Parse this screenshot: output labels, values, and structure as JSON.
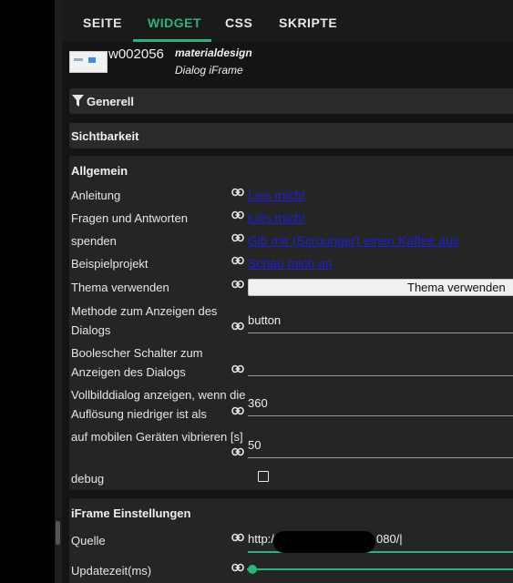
{
  "tabs": [
    {
      "label": "SEITE"
    },
    {
      "label": "WIDGET"
    },
    {
      "label": "CSS"
    },
    {
      "label": "SKRIPTE"
    }
  ],
  "active_tab": "WIDGET",
  "widget": {
    "id": "w002056",
    "set": "materialdesign",
    "name": "Dialog iFrame"
  },
  "sections": {
    "general": "Generell",
    "visibility": "Sichtbarkeit",
    "common": "Allgemein",
    "iframe": "iFrame Einstellungen"
  },
  "common": {
    "anleitung": {
      "label": "Anleitung",
      "link": "Lies mich!"
    },
    "faq": {
      "label": "Fragen und Antworten",
      "link": "Lies mich!"
    },
    "donate": {
      "label": "spenden",
      "link": "Gib mir (Scrounger) einen Kaffee aus"
    },
    "example": {
      "label": "Beispielprojekt",
      "link": "Schau mich an"
    },
    "theme": {
      "label": "Thema verwenden",
      "button": "Thema verwenden"
    },
    "method": {
      "label_line1": "Methode zum Anzeigen des",
      "label_line2": "Dialogs",
      "value": "button"
    },
    "toggle": {
      "label_line1": "Boolescher Schalter zum",
      "label_line2": "Anzeigen des Dialogs",
      "value": ""
    },
    "fullscreen": {
      "label_line1": "Vollbilddialog anzeigen, wenn die",
      "label_line2": "Auflösung niedriger ist als",
      "value": "360"
    },
    "vibrate": {
      "label": "auf mobilen Geräten vibrieren [s]",
      "value": "50"
    },
    "debug": {
      "label": "debug",
      "checked": false
    }
  },
  "iframe": {
    "source": {
      "label": "Quelle",
      "value_start": "http:/",
      "value_end": "080/|"
    },
    "update": {
      "label": "Updatezeit(ms)",
      "value": 0
    }
  },
  "colors": {
    "accent": "#2bb37a",
    "link": "#1e20d6"
  },
  "icons": {
    "filter": "filter-icon",
    "link": "link-icon"
  }
}
